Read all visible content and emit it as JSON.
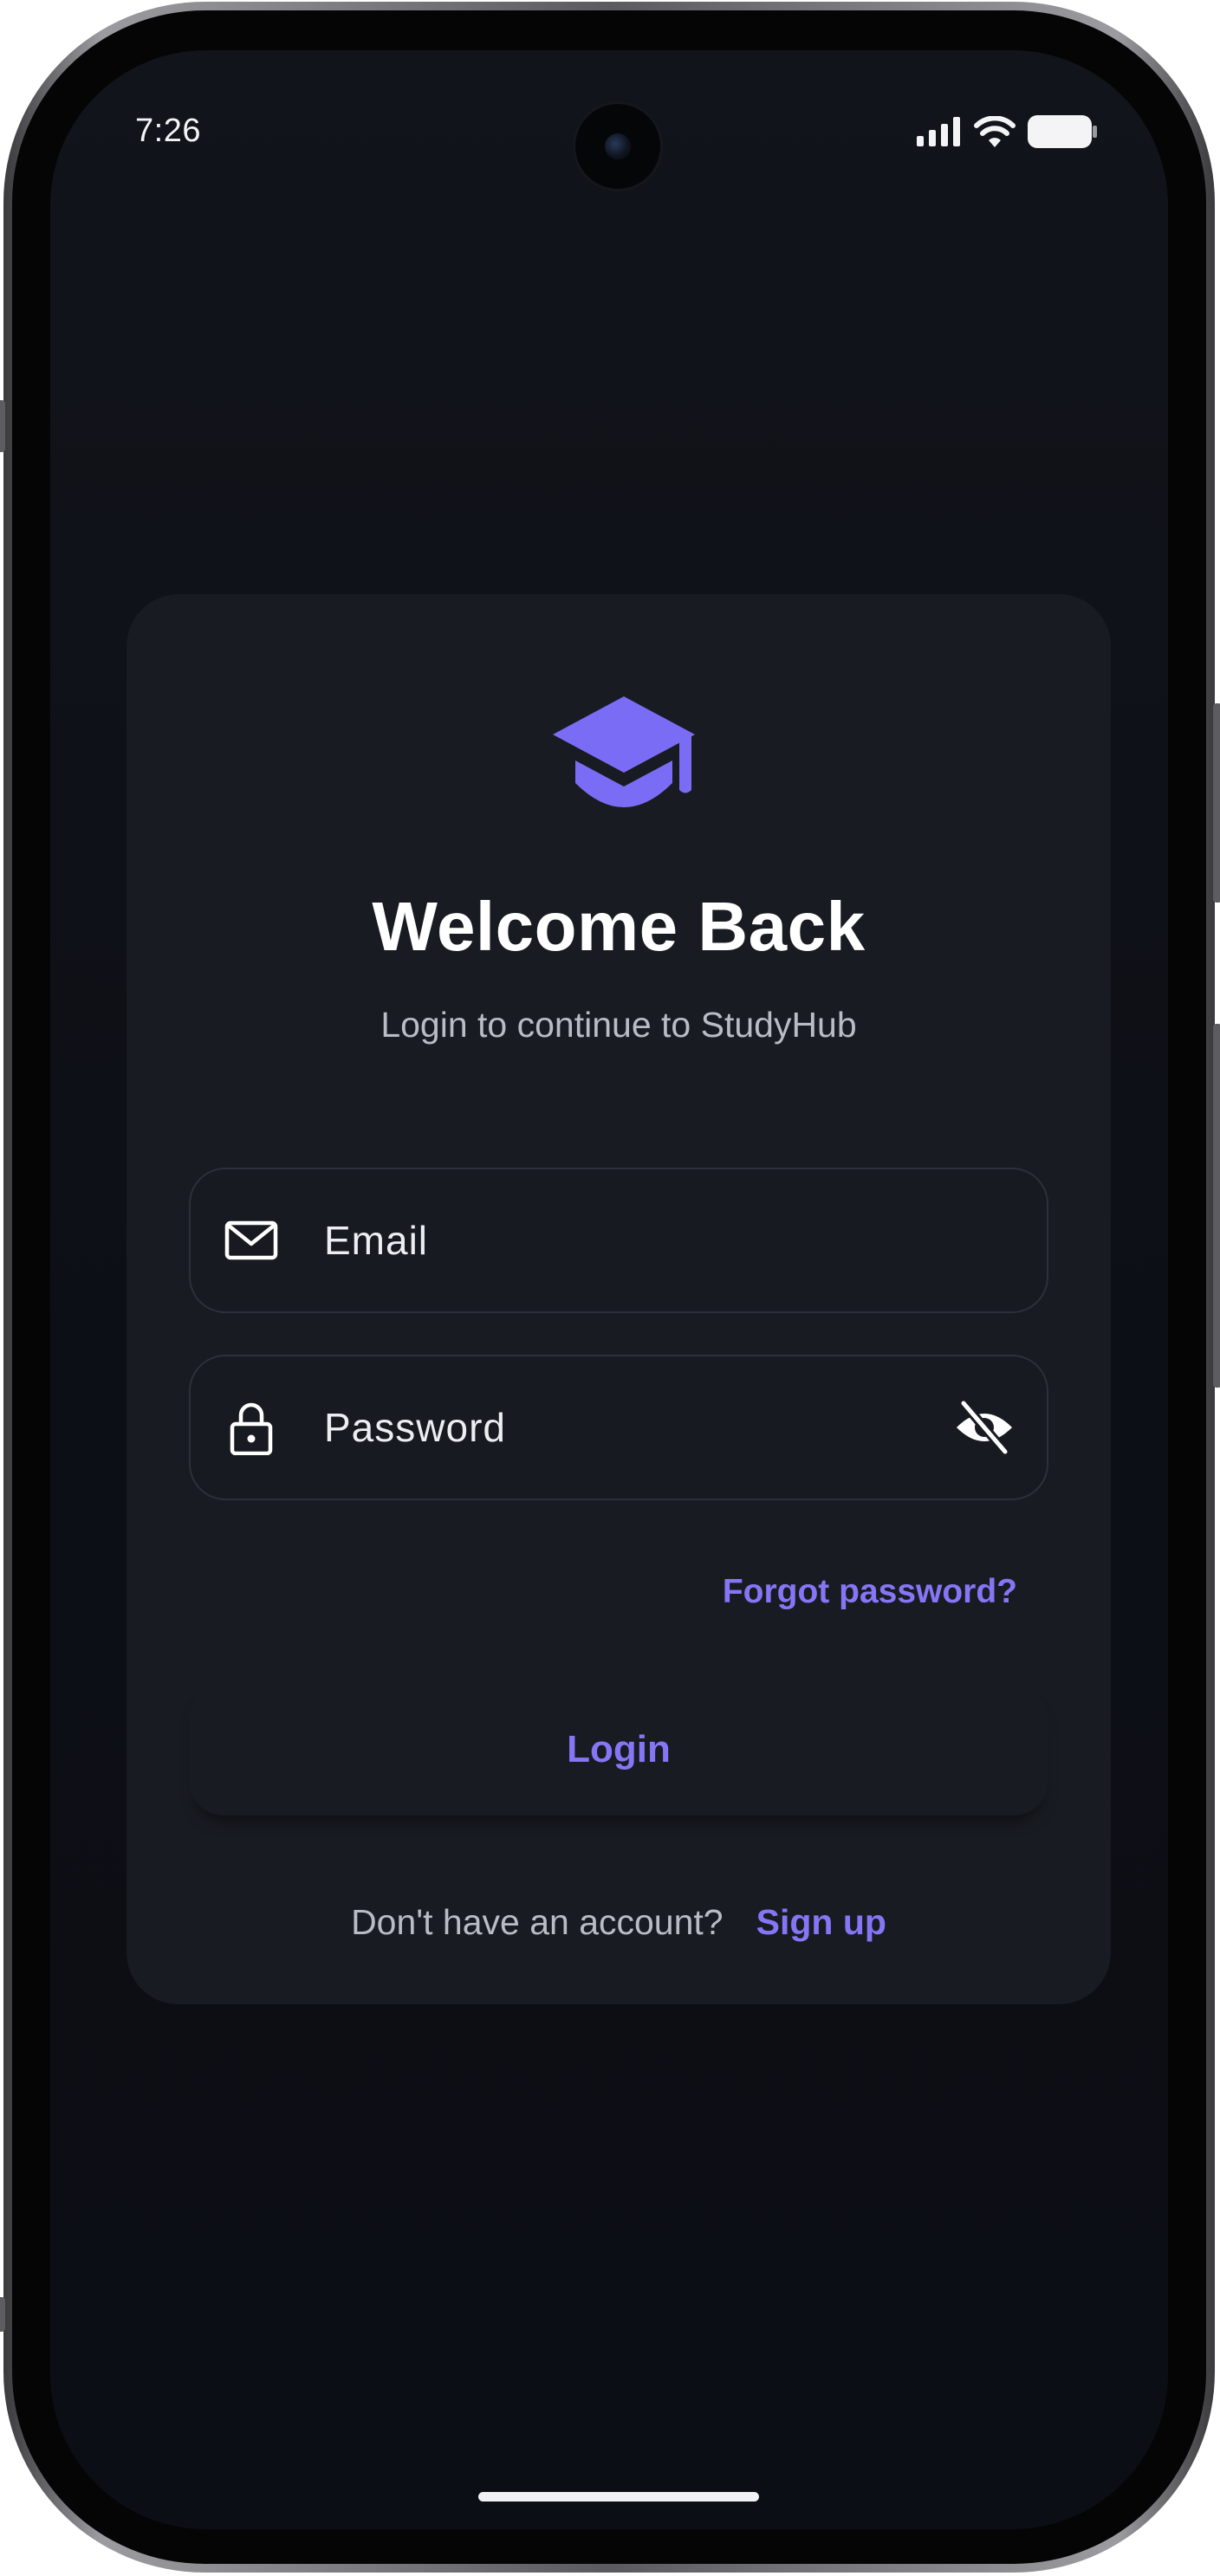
{
  "status_bar": {
    "time": "7:26",
    "icons": [
      "cellular-signal-icon",
      "wifi-icon",
      "battery-icon"
    ]
  },
  "login_card": {
    "logo_icon": "graduation-cap-icon",
    "title": "Welcome Back",
    "subtitle": "Login to continue to StudyHub",
    "email": {
      "icon": "mail-icon",
      "placeholder": "Email",
      "value": ""
    },
    "password": {
      "icon": "lock-icon",
      "placeholder": "Password",
      "value": "",
      "toggle_icon": "eye-off-icon"
    },
    "forgot_password_label": "Forgot password?",
    "login_button_label": "Login",
    "signup_prompt": "Don't have an account?",
    "signup_link_label": "Sign up"
  },
  "colors": {
    "accent": "#8576f5",
    "logo": "#7b6cf6",
    "background": "#0c0f15",
    "card": "#181b21",
    "text_primary": "#ffffff",
    "text_secondary": "#b9bcc4"
  }
}
